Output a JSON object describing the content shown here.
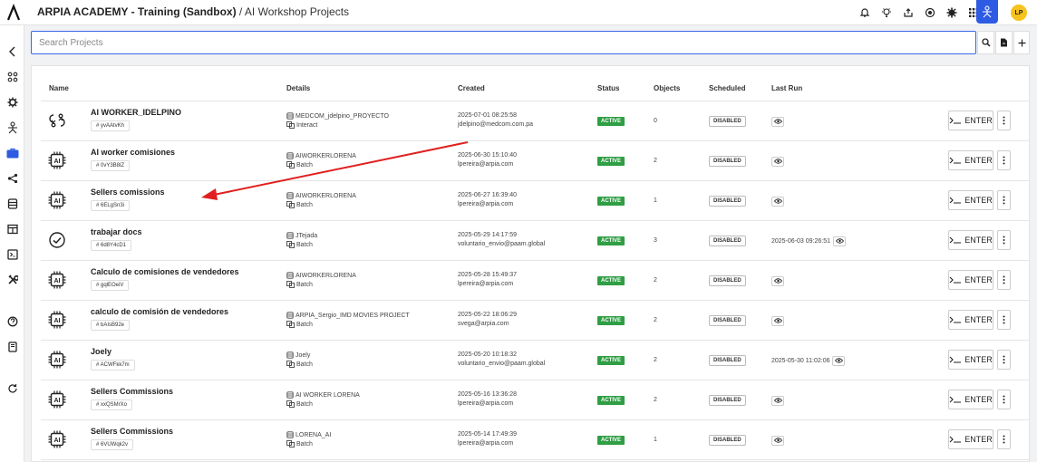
{
  "header": {
    "org": "ARPIA ACADEMY - Training (Sandbox)",
    "separator": " / ",
    "section": "AI Workshop Projects",
    "avatar_initials": "LP"
  },
  "search": {
    "placeholder": "Search Projects"
  },
  "table": {
    "headers": {
      "name": "Name",
      "details": "Details",
      "created": "Created",
      "status": "Status",
      "objects": "Objects",
      "scheduled": "Scheduled",
      "last_run": "Last Run"
    },
    "enter_label": "ENTER",
    "rows": [
      {
        "icon": "workflow-icon",
        "name": "AI WORKER_IDELPINO",
        "code": "# yvAAtvKh",
        "detail1": "MEDCOM_jdelpino_PROYECTO",
        "detail2": "Interact",
        "created_date": "2025-07-01 08:25:58",
        "created_by": "jdelpino@medcom.com.pa",
        "status": "ACTIVE",
        "objects": "0",
        "scheduled": "DISABLED",
        "last_run": ""
      },
      {
        "icon": "ai-chip-icon",
        "name": "AI worker comisiones",
        "code": "# 0vY3B8lZ",
        "detail1": "AIWORKERLORENA",
        "detail2": "Batch",
        "created_date": "2025-06-30 15:10:40",
        "created_by": "lpereira@arpia.com",
        "status": "ACTIVE",
        "objects": "2",
        "scheduled": "DISABLED",
        "last_run": ""
      },
      {
        "icon": "ai-chip-icon",
        "name": "Sellers comissions",
        "code": "# 6ELgSn3i",
        "detail1": "AIWORKERLORENA",
        "detail2": "Batch",
        "created_date": "2025-06-27 16:39:40",
        "created_by": "lpereira@arpia.com",
        "status": "ACTIVE",
        "objects": "1",
        "scheduled": "DISABLED",
        "last_run": ""
      },
      {
        "icon": "check-circle-icon",
        "name": "trabajar docs",
        "code": "# 6d8Y4cD1",
        "detail1": "JTejada",
        "detail2": "Batch",
        "created_date": "2025-05-29 14:17:59",
        "created_by": "voluntario_envio@paam.global",
        "status": "ACTIVE",
        "objects": "3",
        "scheduled": "DISABLED",
        "last_run": "2025-06-03 09:26:51"
      },
      {
        "icon": "ai-chip-icon",
        "name": "Calculo de comisiones de vendedores",
        "code": "# gqlEOeiV",
        "detail1": "AIWORKERLORENA",
        "detail2": "Batch",
        "created_date": "2025-05-28 15:49:37",
        "created_by": "lpereira@arpia.com",
        "status": "ACTIVE",
        "objects": "2",
        "scheduled": "DISABLED",
        "last_run": ""
      },
      {
        "icon": "ai-chip-icon",
        "name": "calculo de comisión de vendedores",
        "code": "# bAIsB92e",
        "detail1": "ARPIA_Sergio_IMD MOVIES PROJECT",
        "detail2": "Batch",
        "created_date": "2025-05-22 18:06:29",
        "created_by": "svega@arpia.com",
        "status": "ACTIVE",
        "objects": "2",
        "scheduled": "DISABLED",
        "last_run": ""
      },
      {
        "icon": "ai-chip-icon",
        "name": "Joely",
        "code": "# ACWFkk7m",
        "detail1": "Joely",
        "detail2": "Batch",
        "created_date": "2025-05-20 10:18:32",
        "created_by": "voluntario_envio@paam.global",
        "status": "ACTIVE",
        "objects": "2",
        "scheduled": "DISABLED",
        "last_run": "2025-05-30 11:02:06"
      },
      {
        "icon": "ai-chip-icon",
        "name": "Sellers Commissions",
        "code": "# xxQSMrXo",
        "detail1": "AI WORKER LORENA",
        "detail2": "Batch",
        "created_date": "2025-05-16 13:36:28",
        "created_by": "lpereira@arpia.com",
        "status": "ACTIVE",
        "objects": "2",
        "scheduled": "DISABLED",
        "last_run": ""
      },
      {
        "icon": "ai-chip-icon",
        "name": "Sellers Commissions",
        "code": "# 6VUWqk2v",
        "detail1": "LORENA_AI",
        "detail2": "Batch",
        "created_date": "2025-05-14 17:49:39",
        "created_by": "lpereira@arpia.com",
        "status": "ACTIVE",
        "objects": "1",
        "scheduled": "DISABLED",
        "last_run": ""
      }
    ]
  },
  "colors": {
    "accent": "#2d5be3",
    "active": "#2f9e44",
    "annotation_arrow": "#e02020"
  }
}
